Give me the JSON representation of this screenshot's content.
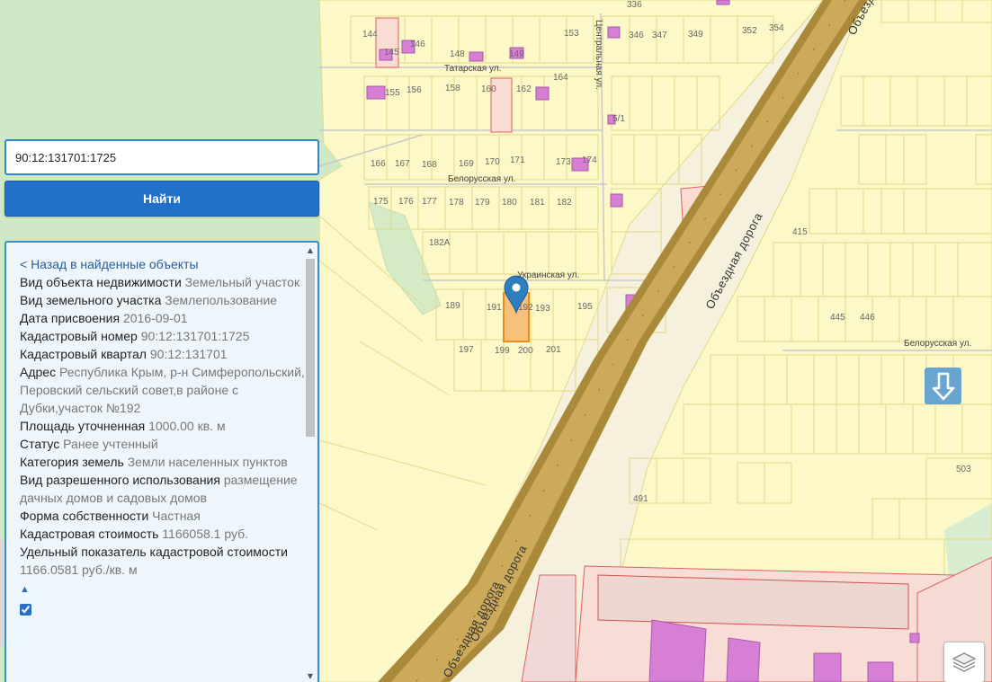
{
  "search": {
    "value": "90:12:131701:1725",
    "button_label": "Найти"
  },
  "info": {
    "back_link": "< Назад в найденные объекты",
    "rows": [
      {
        "label": "Вид объекта недвижимости",
        "value": "Земельный участок"
      },
      {
        "label": "Вид земельного участка",
        "value": "Землепользование"
      },
      {
        "label": "Дата присвоения",
        "value": "2016-09-01"
      },
      {
        "label": "Кадастровый номер",
        "value": "90:12:131701:1725"
      },
      {
        "label": "Кадастровый квартал",
        "value": "90:12:131701"
      },
      {
        "label": "Адрес",
        "value": "Республика Крым, р-н Симферопольский, Перовский сельский совет,в районе с Дубки,участок №192"
      },
      {
        "label": "Площадь уточненная",
        "value": "1000.00 кв. м"
      },
      {
        "label": "Статус",
        "value": "Ранее учтенный"
      },
      {
        "label": "Категория земель",
        "value": "Земли населенных пунктов"
      },
      {
        "label": "Вид разрешенного использования",
        "value": "размещение дачных домов и садовых домов"
      },
      {
        "label": "Форма собственности",
        "value": "Частная"
      },
      {
        "label": "Кадастровая стоимость",
        "value": "1166058.1 руб."
      },
      {
        "label": "Удельный показатель кадастровой стоимости",
        "value": "1166.0581 руб./кв. м"
      }
    ],
    "collapse_symbol": "▲"
  },
  "map": {
    "colors": {
      "parcel_fill": "#fdf8c8",
      "parcel_stroke": "#e2d98a",
      "building": "#d77fd4",
      "selected_fill": "#f6c27a",
      "selected_stroke": "#ec8a1a",
      "road_outer": "#a88a3a",
      "road_inner": "#cda95a",
      "green": "#cfe8c6",
      "red_outline": "#e06060",
      "pin": "#2d7fc0"
    },
    "streets": [
      {
        "name": "Татарская ул."
      },
      {
        "name": "Центральная ул."
      },
      {
        "name": "Белорусская ул."
      },
      {
        "name": "Украинская ул."
      },
      {
        "name": "Белорусская ул."
      }
    ],
    "road_name": "Объездная дорога",
    "parcel_numbers": [
      "144",
      "145",
      "146",
      "148",
      "149",
      "153",
      "155",
      "156",
      "158",
      "160",
      "162",
      "164",
      "166",
      "167",
      "168",
      "169",
      "170",
      "171",
      "173",
      "174",
      "175",
      "176",
      "177",
      "178",
      "179",
      "180",
      "181",
      "182",
      "182А",
      "189",
      "191",
      "192",
      "193",
      "195",
      "197",
      "199",
      "200",
      "201",
      "336",
      "346",
      "347",
      "349",
      "352",
      "354",
      "415",
      "445",
      "446",
      "491",
      "503",
      "5/1"
    ]
  }
}
